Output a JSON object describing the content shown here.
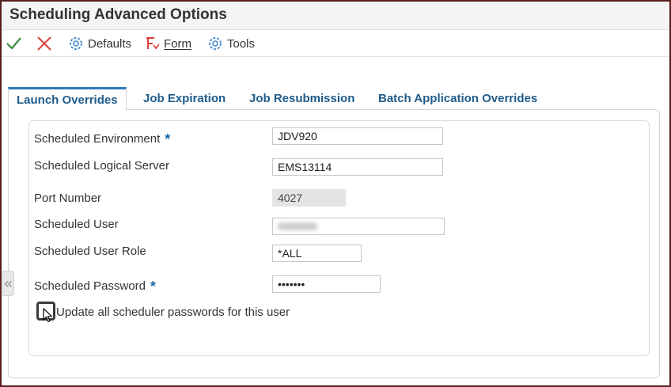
{
  "window": {
    "title": "Scheduling Advanced Options"
  },
  "toolbar": {
    "ok_icon": "checkmark-icon",
    "cancel_icon": "close-icon",
    "defaults_label": "Defaults",
    "form_label": "Form",
    "tools_label": "Tools"
  },
  "tabs": [
    {
      "label": "Launch Overrides",
      "active": true
    },
    {
      "label": "Job Expiration"
    },
    {
      "label": "Job Resubmission"
    },
    {
      "label": "Batch Application Overrides"
    }
  ],
  "form": {
    "env_label": "Scheduled Environment",
    "env_value": "JDV920",
    "server_label": "Scheduled Logical Server",
    "server_value": "EMS13114",
    "port_label": "Port Number",
    "port_value": "4027",
    "user_label": "Scheduled User",
    "role_label": "Scheduled User Role",
    "role_value": "*ALL",
    "password_label": "Scheduled Password",
    "password_value": "•••••••",
    "required_marker": "*",
    "update_checkbox_label": "Update all scheduler passwords for this user",
    "update_checkbox_checked": false
  },
  "side_handle": {
    "glyph": "«"
  },
  "colors": {
    "accent": "#2e7ab8",
    "tab_text": "#1f5b8a",
    "ok_green": "#3a8a3a",
    "cancel_red": "#e0483e",
    "gear_blue": "#4a8fd0",
    "form_red": "#d9403a"
  }
}
